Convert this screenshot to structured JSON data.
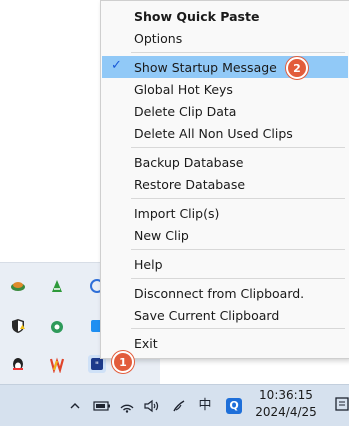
{
  "menu": {
    "items": [
      {
        "label": "Show Quick Paste",
        "bold": true,
        "checked": false
      },
      {
        "label": "Options",
        "bold": false,
        "checked": false
      },
      {
        "label": "Show Startup Message",
        "bold": false,
        "checked": true,
        "highlighted": true
      },
      {
        "label": "Global Hot Keys",
        "bold": false,
        "checked": false
      },
      {
        "label": "Delete Clip Data",
        "bold": false,
        "checked": false
      },
      {
        "label": "Delete All Non Used Clips",
        "bold": false,
        "checked": false
      },
      {
        "label": "Backup Database",
        "bold": false,
        "checked": false
      },
      {
        "label": "Restore Database",
        "bold": false,
        "checked": false
      },
      {
        "label": "Import Clip(s)",
        "bold": false,
        "checked": false
      },
      {
        "label": "New Clip",
        "bold": false,
        "checked": false
      },
      {
        "label": "Help",
        "bold": false,
        "checked": false
      },
      {
        "label": "Disconnect from Clipboard.",
        "bold": false,
        "checked": false
      },
      {
        "label": "Save Current Clipboard",
        "bold": false,
        "checked": false
      },
      {
        "label": "Exit",
        "bold": false,
        "checked": false
      }
    ],
    "check_glyph": "✓"
  },
  "badges": {
    "step1": "1",
    "step2": "2"
  },
  "taskbar": {
    "tray_chevron": "^",
    "ime_indicator": "中",
    "quick_app_label": "Q",
    "time": "10:36:15",
    "date": "2024/4/25"
  },
  "colors": {
    "menu_highlight": "#91c9f7",
    "badge": "#e25c3b",
    "taskbar": "#d6e1ee"
  }
}
